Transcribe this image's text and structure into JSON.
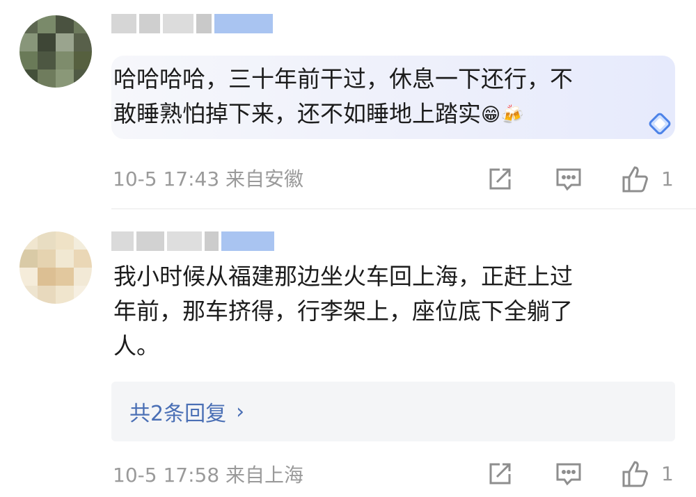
{
  "colors": {
    "avatar1": [
      "#5c6650",
      "#7a8a6a",
      "#4a5240",
      "#6d7a5c",
      "#88967a",
      "#3e4636",
      "#9aa48e",
      "#58604a",
      "#6a7a58",
      "#4d5742",
      "#7e8c6c",
      "#56603f",
      "#44503a",
      "#6f7c5d",
      "#8a9878",
      "#505a44"
    ],
    "avatar2": [
      "#f0e6cf",
      "#e8ddc2",
      "#efe2c6",
      "#f3eddc",
      "#d9caa6",
      "#e5d3b0",
      "#f1e8d2",
      "#ead7b6",
      "#f5ecda",
      "#dcbf93",
      "#e2c89e",
      "#f2e9d6",
      "#eee4cf",
      "#e8d9bd",
      "#f0e5cd",
      "#f6efe1"
    ],
    "name_gray": "#c9c9c9",
    "name_blue": "#a9c4f1",
    "text": "#1c1c1c",
    "meta": "#9a9a9a",
    "link": "#4a6fb5"
  },
  "comments": [
    {
      "text": "哈哈哈哈，三十年前干过，休息一下还行，不\n敢睡熟怕掉下来，还不如睡地上踏实",
      "emoji1": "😁",
      "emoji2": "🍻",
      "meta": "10-5 17:43 来自安徽",
      "likes": "1",
      "icons": [
        "share-icon",
        "comment-icon",
        "thumbs-up-icon",
        "diamond-badge-icon"
      ]
    },
    {
      "text": "我小时候从福建那边坐火车回上海，正赶上过\n年前，那车挤得，行李架上，座位底下全躺了\n人。",
      "replies_label": "共2条回复",
      "replies_chevron": "›",
      "meta": "10-5 17:58 来自上海",
      "likes": "1",
      "icons": [
        "share-icon",
        "comment-icon",
        "thumbs-up-icon",
        "chevron-right-icon"
      ]
    }
  ]
}
